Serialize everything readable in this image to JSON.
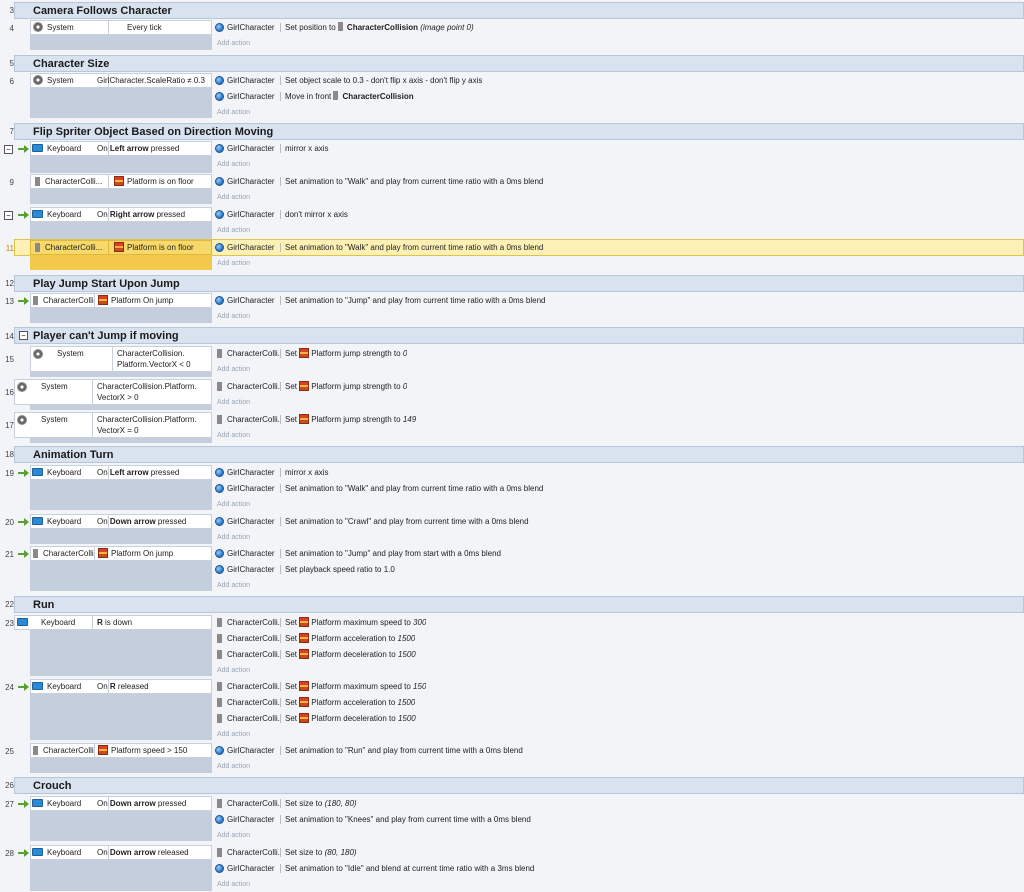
{
  "groups": [
    {
      "num": "3",
      "title": "Camera Follows Character"
    },
    {
      "num": "5",
      "title": "Character Size"
    },
    {
      "num": "7",
      "title": "Flip Spriter Object Based on Direction Moving"
    },
    {
      "num": "12",
      "title": "Play Jump Start Upon Jump"
    },
    {
      "num": "14",
      "title": "Player can't Jump if moving"
    },
    {
      "num": "18",
      "title": "Animation Turn"
    },
    {
      "num": "22",
      "title": "Run"
    },
    {
      "num": "26",
      "title": "Crouch"
    }
  ],
  "events": {
    "e4": {
      "num": "4",
      "obj": "System",
      "cond": "Every tick",
      "actions": [
        {
          "obj": "GirlCharacter",
          "pre": "Set position to ",
          "bold": "CharacterCollision",
          "post": " (image point 0)"
        }
      ]
    },
    "e6": {
      "num": "6",
      "obj": "System",
      "cond": "GirlCharacter.ScaleRatio ≠ 0.3",
      "actions": [
        {
          "obj": "GirlCharacter",
          "text": "Set object scale to 0.3 - don't flip x axis - don't flip y axis"
        },
        {
          "obj": "GirlCharacter",
          "pre": "Move in front ",
          "bold": "CharacterCollision"
        }
      ]
    },
    "e8": {
      "num": "8",
      "obj": "Keyboard",
      "pre": "On ",
      "bold": "Left arrow",
      "post": " pressed",
      "actions": [
        {
          "obj": "GirlCharacter",
          "text": "mirror x axis"
        }
      ]
    },
    "e9": {
      "num": "9",
      "obj": "CharacterColli...",
      "cond": "Platform is on floor",
      "actions": [
        {
          "obj": "GirlCharacter",
          "text": "Set animation to \"Walk\" and play from current time ratio with a 0ms blend"
        }
      ]
    },
    "e10": {
      "num": "10",
      "obj": "Keyboard",
      "pre": "On ",
      "bold": "Right arrow",
      "post": " pressed",
      "actions": [
        {
          "obj": "GirlCharacter",
          "text": "don't mirror x axis"
        }
      ]
    },
    "e11": {
      "num": "11",
      "obj": "CharacterColli...",
      "cond": "Platform is on floor",
      "actions": [
        {
          "obj": "GirlCharacter",
          "text": "Set animation to \"Walk\" and play from current time ratio with a 0ms blend"
        }
      ]
    },
    "e13": {
      "num": "13",
      "obj": "CharacterColli...",
      "cond": "Platform On jump",
      "actions": [
        {
          "obj": "GirlCharacter",
          "text": "Set animation to \"Jump\" and play from current time ratio with a 0ms blend"
        }
      ]
    },
    "e15": {
      "num": "15",
      "obj": "System",
      "cond1": "CharacterCollision.",
      "cond2": "Platform.VectorX < 0",
      "actions": [
        {
          "obj": "CharacterColli...",
          "pre": "Set ",
          "mid": "Platform jump strength to ",
          "val": "0"
        }
      ]
    },
    "e16": {
      "num": "16",
      "obj": "System",
      "cond1": "CharacterCollision.Platform.",
      "cond2": "VectorX > 0",
      "actions": [
        {
          "obj": "CharacterColli...",
          "pre": "Set ",
          "mid": "Platform jump strength to ",
          "val": "0"
        }
      ]
    },
    "e17": {
      "num": "17",
      "obj": "System",
      "cond1": "CharacterCollision.Platform.",
      "cond2": "VectorX = 0",
      "actions": [
        {
          "obj": "CharacterColli...",
          "pre": "Set ",
          "mid": "Platform jump strength to ",
          "val": "149"
        }
      ]
    },
    "e19": {
      "num": "19",
      "obj": "Keyboard",
      "pre": "On ",
      "bold": "Left arrow",
      "post": " pressed",
      "actions": [
        {
          "obj": "GirlCharacter",
          "text": "mirror x axis"
        },
        {
          "obj": "GirlCharacter",
          "text": "Set animation to \"Walk\" and play from current time ratio with a 0ms blend"
        }
      ]
    },
    "e20": {
      "num": "20",
      "obj": "Keyboard",
      "pre": "On ",
      "bold": "Down arrow",
      "post": " pressed",
      "actions": [
        {
          "obj": "GirlCharacter",
          "text": "Set animation to \"Crawl\" and play from current time with a 0ms blend"
        }
      ]
    },
    "e21": {
      "num": "21",
      "obj": "CharacterColli...",
      "cond": "Platform On jump",
      "actions": [
        {
          "obj": "GirlCharacter",
          "text": "Set animation to \"Jump\" and play from start with a 0ms blend"
        },
        {
          "obj": "GirlCharacter",
          "text": "Set playback speed ratio to 1.0"
        }
      ]
    },
    "e23": {
      "num": "23",
      "obj": "Keyboard",
      "bold": "R",
      "post": " is down",
      "actions": [
        {
          "obj": "CharacterColli...",
          "pre": "Set ",
          "mid": "Platform maximum speed to ",
          "val": "300"
        },
        {
          "obj": "CharacterColli...",
          "pre": "Set ",
          "mid": "Platform acceleration to ",
          "val": "1500"
        },
        {
          "obj": "CharacterColli...",
          "pre": "Set ",
          "mid": "Platform deceleration to ",
          "val": "1500"
        }
      ]
    },
    "e24": {
      "num": "24",
      "obj": "Keyboard",
      "pre": "On ",
      "bold": "R",
      "post": " released",
      "actions": [
        {
          "obj": "CharacterColli...",
          "pre": "Set ",
          "mid": "Platform maximum speed to ",
          "val": "150"
        },
        {
          "obj": "CharacterColli...",
          "pre": "Set ",
          "mid": "Platform acceleration to ",
          "val": "1500"
        },
        {
          "obj": "CharacterColli...",
          "pre": "Set ",
          "mid": "Platform deceleration to ",
          "val": "1500"
        }
      ]
    },
    "e25": {
      "num": "25",
      "obj": "CharacterColli...",
      "cond": "Platform speed > 150",
      "actions": [
        {
          "obj": "GirlCharacter",
          "text": "Set animation to \"Run\" and play from current time with a 0ms blend"
        }
      ]
    },
    "e27": {
      "num": "27",
      "obj": "Keyboard",
      "pre": "On ",
      "bold": "Down arrow",
      "post": " pressed",
      "actions": [
        {
          "obj": "CharacterColli...",
          "pre": "Set size to ",
          "val": "(180, 80)"
        },
        {
          "obj": "GirlCharacter",
          "text": "Set animation to \"Knees\" and play from current time with a 0ms blend"
        }
      ]
    },
    "e28": {
      "num": "28",
      "obj": "Keyboard",
      "pre": "On ",
      "bold": "Down arrow",
      "post": " released",
      "actions": [
        {
          "obj": "CharacterColli...",
          "pre": "Set size to ",
          "val": "(80, 180)"
        },
        {
          "obj": "GirlCharacter",
          "text": "Set animation to \"Idle\" and blend at current time ratio with a 3ms blend"
        }
      ]
    }
  },
  "add_action_label": "Add action",
  "collapse_glyph": "−"
}
